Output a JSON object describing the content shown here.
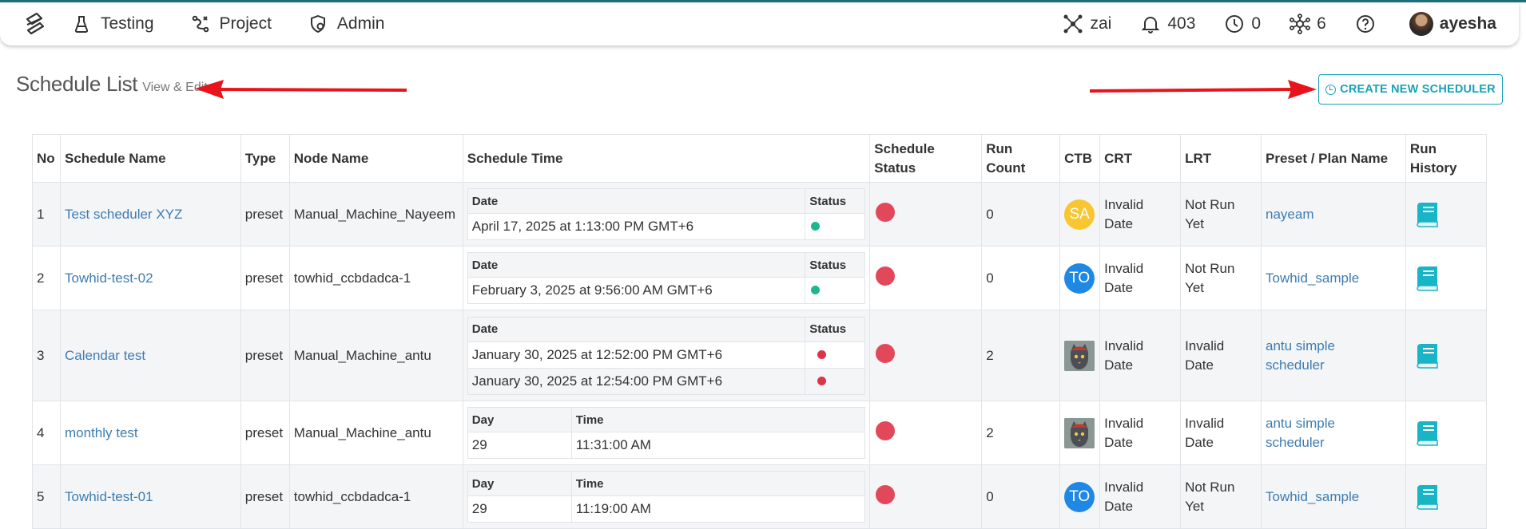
{
  "nav": {
    "left": [
      {
        "label": "Testing",
        "icon": "flask-icon"
      },
      {
        "label": "Project",
        "icon": "workflow-icon"
      },
      {
        "label": "Admin",
        "icon": "shield-icon"
      }
    ],
    "right": {
      "workspace": "zai",
      "notifications": "403",
      "history_count": "0",
      "nodes_count": "6",
      "user": "ayesha"
    }
  },
  "page": {
    "title": "Schedule List",
    "subtitle": "View & Edit",
    "create_button": "CREATE NEW SCHEDULER"
  },
  "table": {
    "headers": {
      "no": "No",
      "name": "Schedule Name",
      "type": "Type",
      "node": "Node Name",
      "time": "Schedule Time",
      "status1": "Schedule",
      "status2": "Status",
      "run1": "Run",
      "run2": "Count",
      "ctb": "CTB",
      "crt": "CRT",
      "lrt": "LRT",
      "preset": "Preset / Plan Name",
      "hist1": "Run",
      "hist2": "History"
    },
    "sub_headers": {
      "date": "Date",
      "status": "Status",
      "day": "Day",
      "time": "Time"
    },
    "rows": [
      {
        "no": "1",
        "name": "Test scheduler XYZ",
        "type": "preset",
        "node": "Manual_Machine_Nayeem",
        "dates": [
          "April 17, 2025 at 1:13:00 PM GMT+6"
        ],
        "run_count": "0",
        "ctb": "SA",
        "crt1": "Invalid",
        "crt2": "Date",
        "lrt1": "Not Run",
        "lrt2": "Yet",
        "preset1": "nayeam",
        "preset2": ""
      },
      {
        "no": "2",
        "name": "Towhid-test-02",
        "type": "preset",
        "node": "towhid_ccbdadca-1",
        "dates": [
          "February 3, 2025 at 9:56:00 AM GMT+6"
        ],
        "run_count": "0",
        "ctb": "TO",
        "crt1": "Invalid",
        "crt2": "Date",
        "lrt1": "Not Run",
        "lrt2": "Yet",
        "preset1": "Towhid_sample",
        "preset2": ""
      },
      {
        "no": "3",
        "name": "Calendar test",
        "type": "preset",
        "node": "Manual_Machine_antu",
        "dates": [
          "January 30, 2025 at 12:52:00 PM GMT+6",
          "January 30, 2025 at 12:54:00 PM GMT+6"
        ],
        "run_count": "2",
        "ctb": "",
        "crt1": "Invalid",
        "crt2": "Date",
        "lrt1": "Invalid",
        "lrt2": "Date",
        "preset1": "antu simple",
        "preset2": "scheduler"
      },
      {
        "no": "4",
        "name": "monthly test",
        "type": "preset",
        "node": "Manual_Machine_antu",
        "day": "29",
        "time": "11:31:00 AM",
        "run_count": "2",
        "ctb": "",
        "crt1": "Invalid",
        "crt2": "Date",
        "lrt1": "Invalid",
        "lrt2": "Date",
        "preset1": "antu simple",
        "preset2": "scheduler"
      },
      {
        "no": "5",
        "name": "Towhid-test-01",
        "type": "preset",
        "node": "towhid_ccbdadca-1",
        "day": "29",
        "time": "11:19:00 AM",
        "run_count": "0",
        "ctb": "TO",
        "crt1": "Invalid",
        "crt2": "Date",
        "lrt1": "Not Run",
        "lrt2": "Yet",
        "preset1": "Towhid_sample",
        "preset2": ""
      }
    ]
  },
  "colors": {
    "accent": "#17a2b8",
    "link": "#3e7cb1",
    "status_red": "#e3485a",
    "status_green": "#20b58f",
    "annotation_arrow": "#e8141b"
  }
}
